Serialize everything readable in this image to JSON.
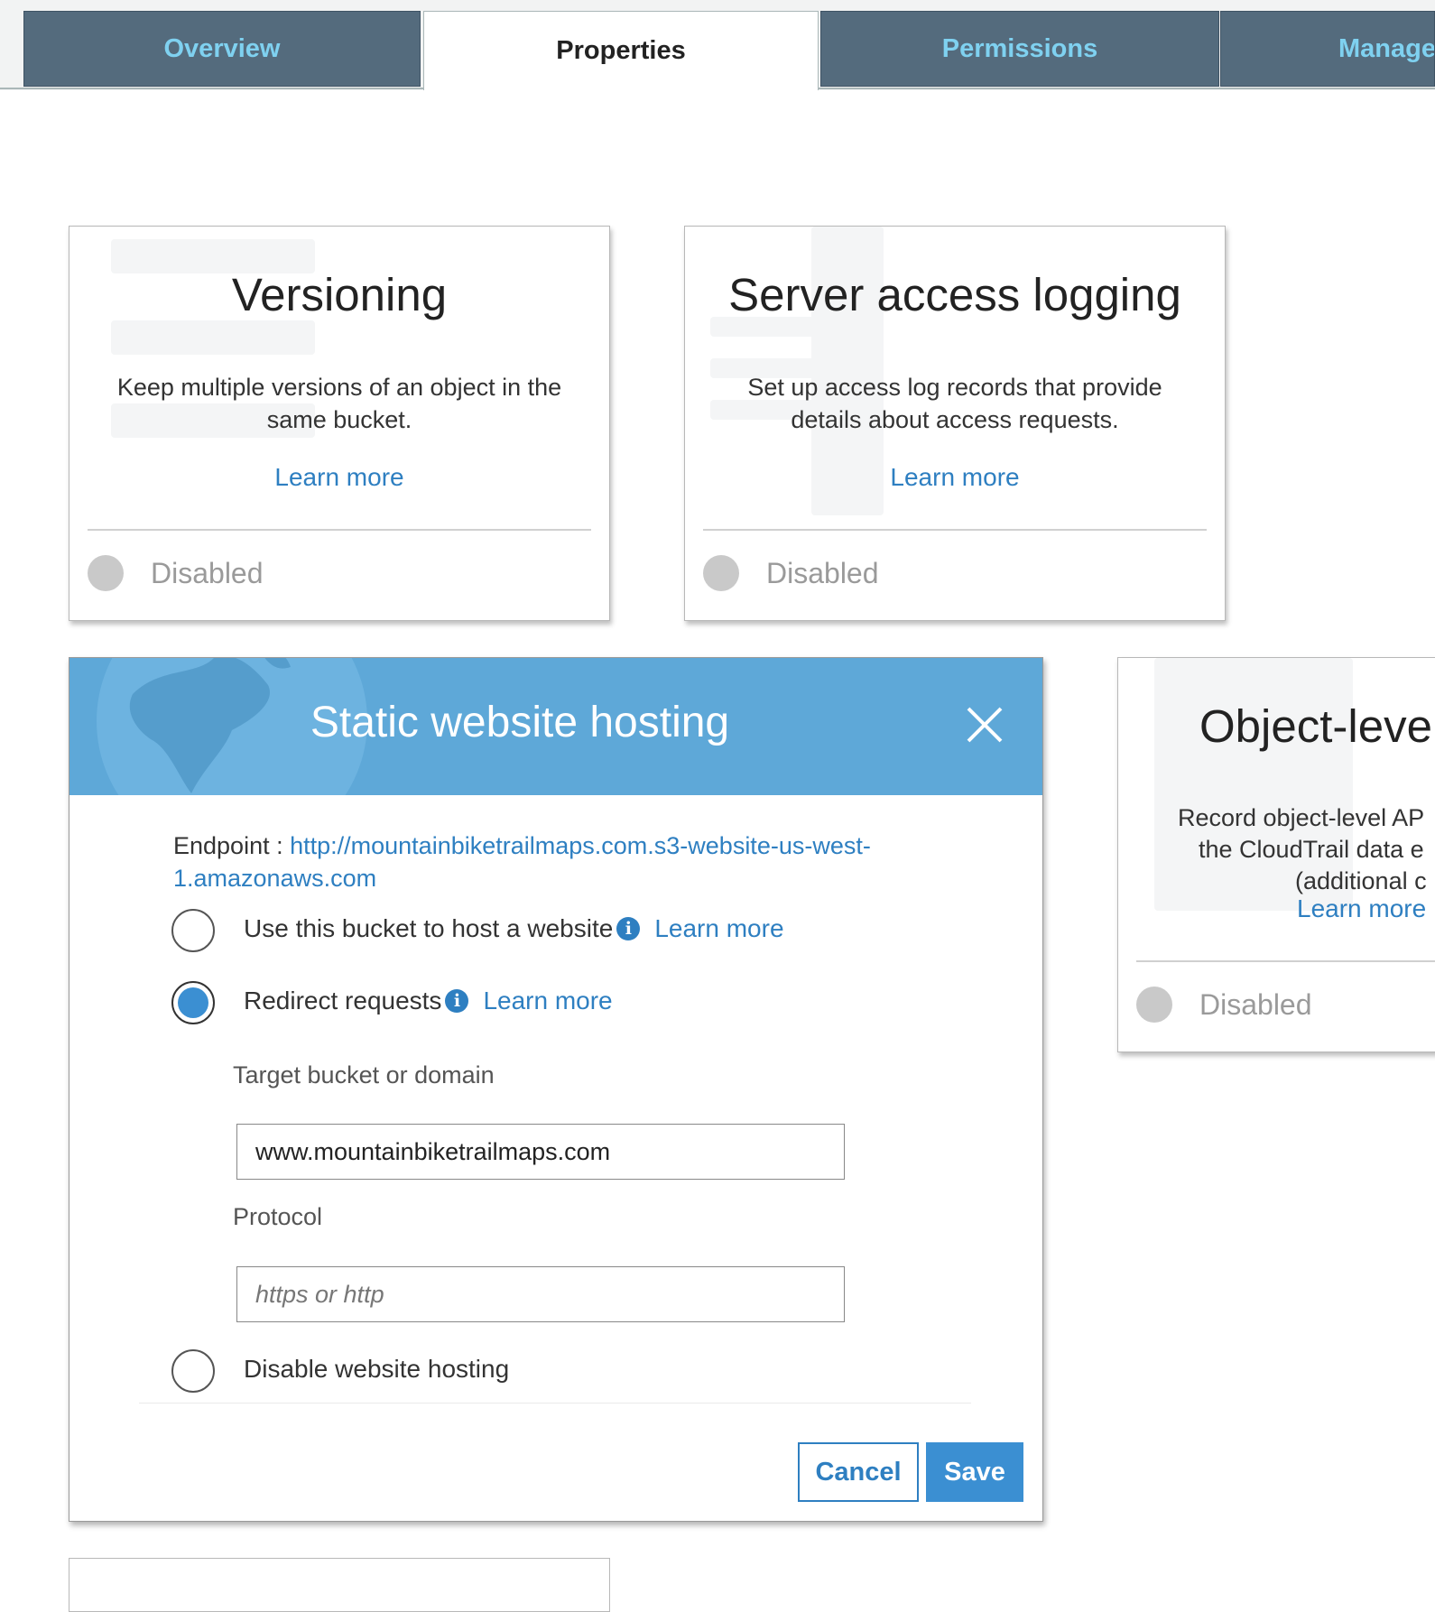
{
  "tabs": [
    {
      "label": "Overview",
      "active": false
    },
    {
      "label": "Properties",
      "active": true
    },
    {
      "label": "Permissions",
      "active": false
    },
    {
      "label": "Manage",
      "active": false
    }
  ],
  "cards": {
    "versioning": {
      "title": "Versioning",
      "description": "Keep multiple versions of an object in the same bucket.",
      "link": "Learn more",
      "status": "Disabled"
    },
    "logging": {
      "title": "Server access logging",
      "description": "Set up access log records that provide details about access requests.",
      "link": "Learn more",
      "status": "Disabled"
    },
    "object_level": {
      "title": "Object-level",
      "desc_line1": "Record object-level AP",
      "desc_line2": "the CloudTrail data e",
      "desc_line3": "(additional c",
      "link": "Learn more",
      "status": "Disabled"
    }
  },
  "modal": {
    "title": "Static website hosting",
    "endpoint_label": "Endpoint : ",
    "endpoint_url": "http://mountainbiketrailmaps.com.s3-website-us-west-1.amazonaws.com",
    "options": [
      {
        "label": "Use this bucket to host a website",
        "link": "Learn more",
        "checked": false
      },
      {
        "label": "Redirect requests",
        "link": "Learn more",
        "checked": true
      },
      {
        "label": "Disable website hosting",
        "checked": false
      }
    ],
    "target_label": "Target bucket or domain",
    "target_value": "www.mountainbiketrailmaps.com",
    "protocol_label": "Protocol",
    "protocol_placeholder": "https or http",
    "cancel": "Cancel",
    "save": "Save"
  },
  "colors": {
    "tab_bg": "#546b7d",
    "tab_text": "#7fd1f0",
    "header_blue": "#5ea8d8",
    "link_blue": "#2e7fc1",
    "button_blue": "#3b8fd2"
  }
}
